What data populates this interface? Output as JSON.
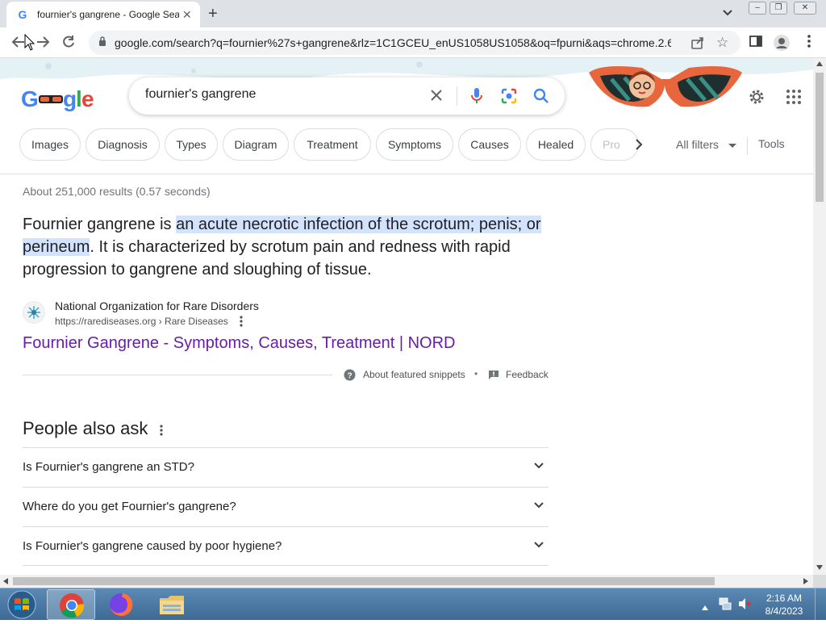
{
  "browser": {
    "tab_title": "fournier's gangrene - Google Sea",
    "tab_favicon": "G",
    "url": "google.com/search?q=fournier%27s+gangrene&rlz=1C1GCEU_enUS1058US1058&oq=fpurni&aqs=chrome.2.69..."
  },
  "search": {
    "query": "fournier's gangrene",
    "logo_text": "Google"
  },
  "chips": [
    "Images",
    "Diagnosis",
    "Types",
    "Diagram",
    "Treatment",
    "Symptoms",
    "Causes",
    "Healed",
    "Pro"
  ],
  "filters": {
    "all_filters": "All filters",
    "tools": "Tools"
  },
  "results": {
    "stats": "About 251,000 results (0.57 seconds)",
    "snippet_prefix": "Fournier gangrene is ",
    "snippet_highlight": "an acute necrotic infection of the scrotum; penis; or perineum",
    "snippet_suffix": ". It is characterized by scrotum pain and redness with rapid progression to gangrene and sloughing of tissue.",
    "source_name": "National Organization for Rare Disorders",
    "source_url": "https://rarediseases.org › Rare Diseases",
    "link_title": "Fournier Gangrene - Symptoms, Causes, Treatment | NORD",
    "about_snippets": "About featured snippets",
    "bullet": "•",
    "feedback": "Feedback"
  },
  "paa": {
    "heading": "People also ask",
    "questions": [
      "Is Fournier's gangrene an STD?",
      "Where do you get Fournier's gangrene?",
      "Is Fournier's gangrene caused by poor hygiene?"
    ]
  },
  "taskbar": {
    "time": "2:16 AM",
    "date": "8/4/2023"
  },
  "colors": {
    "link": "#681da8",
    "highlight": "#d3e3fd",
    "accent": "#4285f4"
  }
}
